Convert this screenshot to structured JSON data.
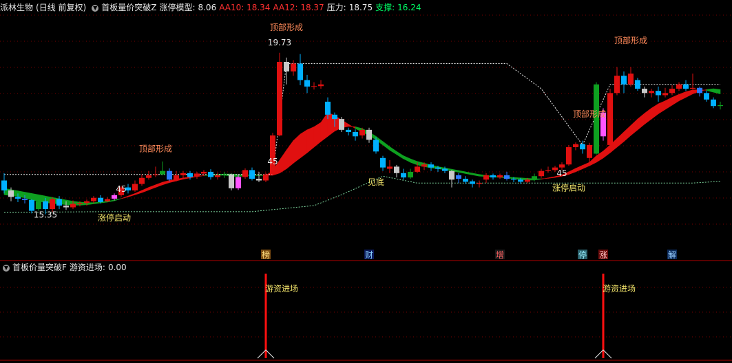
{
  "header": {
    "stock_name": "派林生物",
    "period_label": "(日线 前复权)",
    "indicator_name": "首板量价突破Z",
    "model_label": "涨停模型:",
    "model_value": "8.06",
    "aa10": "AA10: 18.34",
    "aa12": "AA12: 18.37",
    "pressure_label": "压力:",
    "pressure_value": "18.75",
    "support_label": "支撑:",
    "support_value": "16.24",
    "colors": {
      "aa10": "#ff3030",
      "aa12": "#ff3030",
      "support": "#00ff66",
      "text": "#e8e8e8"
    }
  },
  "subpanel": {
    "indicator_name": "首板价量突破F",
    "label": "游资进场:",
    "value": "0.00"
  },
  "chart_data": {
    "type": "candlestick",
    "y_range": [
      15.2,
      20.6
    ],
    "candles": [
      [
        16.78,
        16.55,
        16.95,
        16.48
      ],
      [
        16.55,
        16.4,
        16.62,
        16.3
      ],
      [
        16.4,
        16.36,
        16.48,
        16.28
      ],
      [
        16.36,
        16.33,
        16.44,
        16.25
      ],
      [
        16.33,
        16.08,
        16.35,
        16.02
      ],
      [
        16.12,
        16.3,
        16.36,
        16.08
      ],
      [
        16.3,
        16.12,
        16.38,
        16.0
      ],
      [
        16.12,
        16.35,
        16.4,
        16.05
      ],
      [
        16.35,
        16.2,
        16.42,
        16.12
      ],
      [
        16.2,
        16.16,
        16.3,
        16.1
      ],
      [
        16.16,
        16.24,
        16.32,
        16.12
      ],
      [
        16.24,
        16.26,
        16.3,
        16.18
      ],
      [
        16.26,
        16.3,
        16.34,
        16.2
      ],
      [
        16.3,
        16.38,
        16.42,
        16.25
      ],
      [
        16.38,
        16.28,
        16.44,
        16.25
      ],
      [
        16.3,
        16.35,
        16.4,
        16.28
      ],
      [
        16.36,
        16.44,
        16.48,
        16.32
      ],
      [
        16.44,
        16.62,
        16.66,
        16.4
      ],
      [
        16.62,
        16.55,
        16.7,
        16.48
      ],
      [
        16.55,
        16.7,
        16.78,
        16.52
      ],
      [
        16.7,
        16.84,
        16.92,
        16.66
      ],
      [
        16.84,
        16.9,
        17.0,
        16.8
      ],
      [
        16.9,
        16.92,
        17.1,
        16.86
      ],
      [
        16.92,
        17.0,
        17.22,
        16.9
      ],
      [
        17.0,
        16.8,
        17.06,
        16.76
      ],
      [
        16.8,
        16.9,
        17.0,
        16.76
      ],
      [
        16.9,
        16.95,
        17.0,
        16.82
      ],
      [
        16.95,
        16.86,
        17.0,
        16.8
      ],
      [
        16.88,
        16.94,
        16.98,
        16.82
      ],
      [
        16.94,
        16.98,
        17.02,
        16.88
      ],
      [
        16.98,
        16.86,
        17.04,
        16.8
      ],
      [
        16.86,
        16.9,
        16.96,
        16.8
      ],
      [
        16.9,
        16.92,
        16.98,
        16.84
      ],
      [
        16.92,
        16.6,
        16.94,
        16.55
      ],
      [
        16.6,
        16.86,
        16.92,
        16.56
      ],
      [
        16.86,
        17.02,
        17.06,
        16.82
      ],
      [
        17.02,
        16.82,
        17.08,
        16.78
      ],
      [
        16.82,
        16.78,
        16.98,
        16.74
      ],
      [
        16.78,
        16.92,
        16.96,
        16.74
      ],
      [
        16.92,
        17.82,
        17.88,
        16.9
      ],
      [
        17.82,
        19.52,
        19.73,
        17.8
      ],
      [
        19.52,
        19.3,
        19.62,
        19.0
      ],
      [
        19.3,
        19.48,
        19.56,
        19.2
      ],
      [
        19.48,
        19.1,
        19.7,
        18.98
      ],
      [
        19.1,
        18.95,
        19.22,
        18.8
      ],
      [
        18.95,
        18.96,
        19.05,
        18.88
      ],
      [
        18.96,
        19.0,
        19.1,
        18.9
      ],
      [
        18.6,
        18.3,
        18.7,
        18.2
      ],
      [
        18.3,
        18.2,
        18.35,
        18.02
      ],
      [
        18.2,
        17.95,
        18.25,
        17.9
      ],
      [
        17.95,
        17.9,
        18.0,
        17.82
      ],
      [
        17.9,
        17.8,
        17.96,
        17.7
      ],
      [
        17.82,
        17.95,
        18.0,
        17.75
      ],
      [
        17.95,
        17.72,
        18.0,
        17.65
      ],
      [
        17.72,
        17.45,
        17.78,
        17.4
      ],
      [
        17.3,
        17.08,
        17.35,
        17.0
      ],
      [
        17.05,
        17.1,
        17.25,
        16.95
      ],
      [
        17.1,
        16.95,
        17.14,
        16.85
      ],
      [
        16.95,
        16.85,
        17.05,
        16.8
      ],
      [
        16.85,
        16.98,
        17.05,
        16.82
      ],
      [
        16.98,
        17.1,
        17.2,
        16.95
      ],
      [
        17.1,
        17.15,
        17.2,
        17.02
      ],
      [
        17.15,
        17.08,
        17.2,
        17.0
      ],
      [
        17.08,
        17.05,
        17.12,
        16.98
      ],
      [
        17.05,
        17.0,
        17.1,
        16.95
      ],
      [
        17.0,
        16.8,
        17.02,
        16.62
      ],
      [
        16.9,
        16.82,
        16.95,
        16.72
      ],
      [
        16.82,
        16.75,
        16.88,
        16.7
      ],
      [
        16.76,
        16.7,
        16.8,
        16.62
      ],
      [
        16.7,
        16.72,
        16.78,
        16.62
      ],
      [
        16.8,
        16.9,
        16.95,
        16.72
      ],
      [
        16.9,
        16.85,
        16.94,
        16.8
      ],
      [
        16.85,
        16.9,
        16.94,
        16.82
      ],
      [
        16.9,
        16.82,
        16.98,
        16.78
      ],
      [
        16.82,
        16.8,
        16.86,
        16.74
      ],
      [
        16.8,
        16.75,
        16.84,
        16.7
      ],
      [
        16.75,
        16.8,
        16.84,
        16.72
      ],
      [
        16.8,
        16.88,
        16.94,
        16.76
      ],
      [
        16.88,
        17.0,
        17.05,
        16.84
      ],
      [
        17.0,
        17.02,
        17.1,
        16.96
      ],
      [
        17.02,
        17.08,
        17.12,
        16.98
      ],
      [
        17.08,
        17.15,
        17.2,
        17.02
      ],
      [
        17.15,
        17.55,
        17.6,
        17.12
      ],
      [
        17.55,
        17.62,
        17.66,
        17.48
      ],
      [
        17.62,
        17.5,
        17.7,
        17.4
      ],
      [
        17.3,
        17.6,
        17.65,
        17.2
      ],
      [
        17.4,
        19.0,
        19.05,
        17.38
      ],
      [
        17.8,
        18.35,
        18.45,
        17.7
      ],
      [
        17.6,
        18.8,
        18.9,
        17.55
      ],
      [
        18.8,
        19.2,
        19.4,
        18.75
      ],
      [
        19.2,
        19.0,
        19.3,
        18.8
      ],
      [
        19.0,
        19.25,
        19.4,
        18.95
      ],
      [
        19.1,
        18.9,
        19.15,
        18.85
      ],
      [
        18.9,
        18.8,
        18.95,
        18.7
      ],
      [
        18.8,
        18.85,
        18.9,
        18.7
      ],
      [
        18.85,
        18.75,
        18.95,
        18.6
      ],
      [
        18.75,
        18.8,
        18.92,
        18.7
      ],
      [
        18.8,
        18.9,
        18.98,
        18.75
      ],
      [
        18.9,
        19.0,
        19.05,
        18.85
      ],
      [
        19.0,
        18.9,
        19.1,
        18.85
      ],
      [
        18.9,
        18.92,
        19.25,
        18.88
      ],
      [
        18.92,
        18.8,
        18.95,
        18.72
      ],
      [
        18.8,
        18.65,
        18.85,
        18.6
      ],
      [
        18.65,
        18.5,
        18.7,
        18.45
      ],
      [
        18.5,
        18.52,
        18.6,
        18.42
      ]
    ],
    "ribbon_fast": [
      16.45,
      16.43,
      16.41,
      16.38,
      16.33,
      16.3,
      16.27,
      16.25,
      16.24,
      16.22,
      16.21,
      16.21,
      16.22,
      16.24,
      16.26,
      16.28,
      16.31,
      16.36,
      16.42,
      16.48,
      16.55,
      16.62,
      16.68,
      16.74,
      16.78,
      16.81,
      16.84,
      16.86,
      16.88,
      16.89,
      16.9,
      16.9,
      16.9,
      16.88,
      16.87,
      16.89,
      16.9,
      16.89,
      16.9,
      17.0,
      17.25,
      17.48,
      17.7,
      17.85,
      17.95,
      18.02,
      18.12,
      18.35,
      18.28,
      18.18,
      18.08,
      17.98,
      17.9,
      17.82,
      17.72,
      17.6,
      17.48,
      17.38,
      17.28,
      17.2,
      17.14,
      17.1,
      17.07,
      17.05,
      17.03,
      17.0,
      16.97,
      16.94,
      16.91,
      16.88,
      16.87,
      16.86,
      16.85,
      16.84,
      16.82,
      16.8,
      16.79,
      16.79,
      16.81,
      16.84,
      16.87,
      16.91,
      16.98,
      17.06,
      17.13,
      17.2,
      17.35,
      17.46,
      17.6,
      17.75,
      17.9,
      18.05,
      18.2,
      18.33,
      18.45,
      18.55,
      18.62,
      18.7,
      18.77,
      18.83,
      18.87,
      18.88,
      18.86,
      18.82,
      18.78
    ],
    "ribbon_slow": [
      16.6,
      16.57,
      16.54,
      16.51,
      16.48,
      16.45,
      16.42,
      16.39,
      16.36,
      16.33,
      16.3,
      16.28,
      16.27,
      16.27,
      16.28,
      16.3,
      16.33,
      16.36,
      16.4,
      16.45,
      16.5,
      16.56,
      16.62,
      16.68,
      16.73,
      16.77,
      16.81,
      16.84,
      16.87,
      16.89,
      16.91,
      16.92,
      16.93,
      16.93,
      16.92,
      16.91,
      16.91,
      16.9,
      16.9,
      16.9,
      16.95,
      17.05,
      17.18,
      17.3,
      17.42,
      17.55,
      17.68,
      17.8,
      17.92,
      18.0,
      18.03,
      18.02,
      17.98,
      17.9,
      17.8,
      17.68,
      17.56,
      17.45,
      17.35,
      17.28,
      17.22,
      17.18,
      17.14,
      17.1,
      17.07,
      17.04,
      17.01,
      16.98,
      16.95,
      16.92,
      16.9,
      16.88,
      16.87,
      16.86,
      16.85,
      16.84,
      16.83,
      16.82,
      16.82,
      16.83,
      16.85,
      16.88,
      16.92,
      16.98,
      17.05,
      17.12,
      17.2,
      17.3,
      17.42,
      17.55,
      17.68,
      17.82,
      17.95,
      18.08,
      18.2,
      18.32,
      18.42,
      18.52,
      18.62,
      18.7,
      18.78,
      18.84,
      18.88,
      18.9,
      18.88
    ],
    "upper_line": [
      [
        0,
        16.92
      ],
      [
        39,
        16.92
      ],
      [
        41,
        19.48
      ],
      [
        73,
        19.48
      ],
      [
        78,
        18.9
      ],
      [
        84,
        17.6
      ],
      [
        88,
        19.0
      ],
      [
        104,
        19.0
      ]
    ],
    "lower_line": [
      [
        0,
        16.04
      ],
      [
        6,
        16.05
      ],
      [
        15,
        16.06
      ],
      [
        36,
        16.06
      ],
      [
        45,
        16.2
      ],
      [
        49,
        16.45
      ],
      [
        55,
        16.88
      ],
      [
        60,
        16.72
      ],
      [
        100,
        16.72
      ],
      [
        104,
        16.76
      ]
    ],
    "annotations": [
      {
        "text": "顶部形成",
        "i": 22,
        "y": 17.45,
        "color": "#ff8a5a"
      },
      {
        "text": "顶部形成",
        "i": 41,
        "y": 20.25,
        "color": "#ff8a5a"
      },
      {
        "text": "顶部形成",
        "i": 85,
        "y": 18.25,
        "color": "#ff8a5a"
      },
      {
        "text": "顶部形成",
        "i": 91,
        "y": 19.95,
        "color": "#ff8a5a"
      },
      {
        "text": "涨停启动",
        "i": 16,
        "y": 15.85,
        "color": "#f0e26a"
      },
      {
        "text": "涨停启动",
        "i": 82,
        "y": 16.54,
        "color": "#f0e26a"
      },
      {
        "text": "见底",
        "i": 54,
        "y": 16.68,
        "color": "#f0e26a"
      },
      {
        "text": "45",
        "i": 17,
        "y": 16.52,
        "color": "#e8e8e8"
      },
      {
        "text": "45",
        "i": 39,
        "y": 17.15,
        "color": "#e8e8e8"
      },
      {
        "text": "45",
        "i": 81,
        "y": 16.88,
        "color": "#e8e8e8"
      },
      {
        "text": "19.73",
        "i": 40,
        "y": 19.9,
        "color": "#e8e8e8"
      },
      {
        "text": "15.35",
        "i": 6,
        "y": 15.92,
        "color": "#e8e8e8"
      }
    ],
    "markers": [
      {
        "text": "榜",
        "i": 38,
        "bg": "#7a4a10",
        "fg": "#ffe080"
      },
      {
        "text": "财",
        "i": 53,
        "bg": "#0b1a5a",
        "fg": "#8ad0ff"
      },
      {
        "text": "增",
        "i": 72,
        "bg": "#1a1a1a",
        "fg": "#ff6060"
      },
      {
        "text": "停",
        "i": 84,
        "bg": "#2a5f6a",
        "fg": "#9af0ff"
      },
      {
        "text": "涨",
        "i": 87,
        "bg": "#6a0a0a",
        "fg": "#ffc0c0"
      },
      {
        "text": "解",
        "i": 97,
        "bg": "#0b2a5a",
        "fg": "#9ad0ff"
      }
    ],
    "signals": [
      {
        "i": 38,
        "label": "游资进场"
      },
      {
        "i": 87,
        "label": "游资进场"
      }
    ]
  }
}
